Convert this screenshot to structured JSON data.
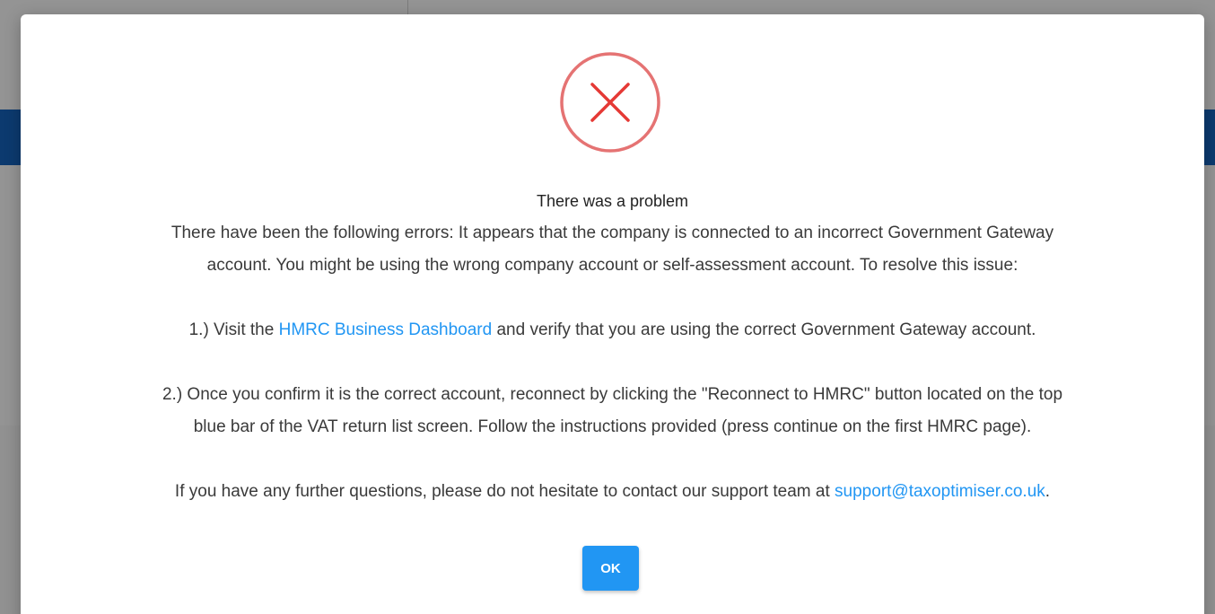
{
  "dialog": {
    "icon": "error-circle-x-icon",
    "title": "There was a problem",
    "intro_line1": "There have been the following errors: It appears that the company is connected to an incorrect Government Gateway",
    "intro_line2": "account. You might be using the wrong company account or self-assessment account. To resolve this issue:",
    "step1_prefix": "1.) Visit the ",
    "step1_link": "HMRC Business Dashboard",
    "step1_suffix": " and verify that you are using the correct Government Gateway account.",
    "step2_line1": "2.) Once you confirm it is the correct account, reconnect by clicking the \"Reconnect to HMRC\" button located on the top",
    "step2_line2": "blue bar of the VAT return list screen. Follow the instructions provided (press continue on the first HMRC page).",
    "contact_prefix": "If you have any further questions, please do not hesitate to contact our support team at ",
    "contact_email": "support@taxoptimiser.co.uk",
    "contact_suffix": ".",
    "ok_label": "OK"
  },
  "colors": {
    "error": "#e53935",
    "link": "#2196f3",
    "button": "#2196f3",
    "background_bar": "#1565c0"
  }
}
